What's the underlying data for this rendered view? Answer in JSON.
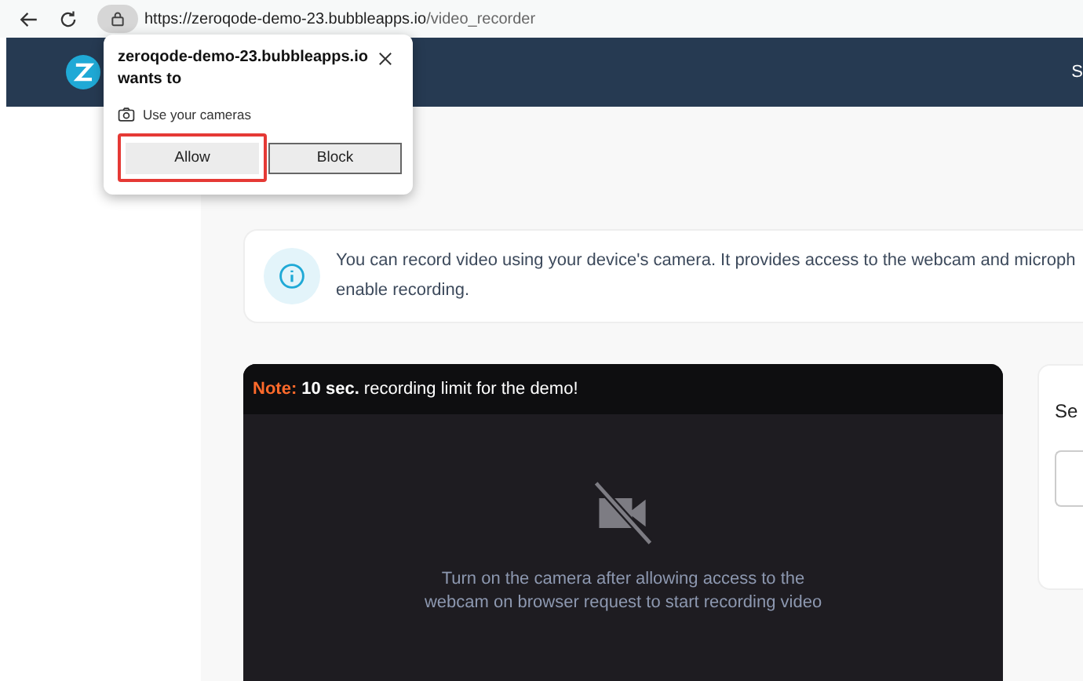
{
  "browser": {
    "url_host": "https://zeroqode-demo-23.bubbleapps.io",
    "url_path": "/video_recorder"
  },
  "header": {
    "right_text": "S"
  },
  "info": {
    "text": "You can record video using your device's camera. It provides access to the webcam and microph\nenable recording."
  },
  "recorder": {
    "note_label": "Note:",
    "note_text": "**10 sec.** recording limit for the demo!",
    "message": "Turn on the camera after allowing access to the\nwebcam on browser request to start recording video"
  },
  "side_panel": {
    "title": "Se"
  },
  "permission_popup": {
    "site": "zeroqode-demo-23.bubbleapps.io",
    "prompt": "wants to",
    "permission": "Use your cameras",
    "buttons": [
      {
        "label": "Allow",
        "highlighted": true
      },
      {
        "label": "Block",
        "highlighted": false
      }
    ]
  }
}
